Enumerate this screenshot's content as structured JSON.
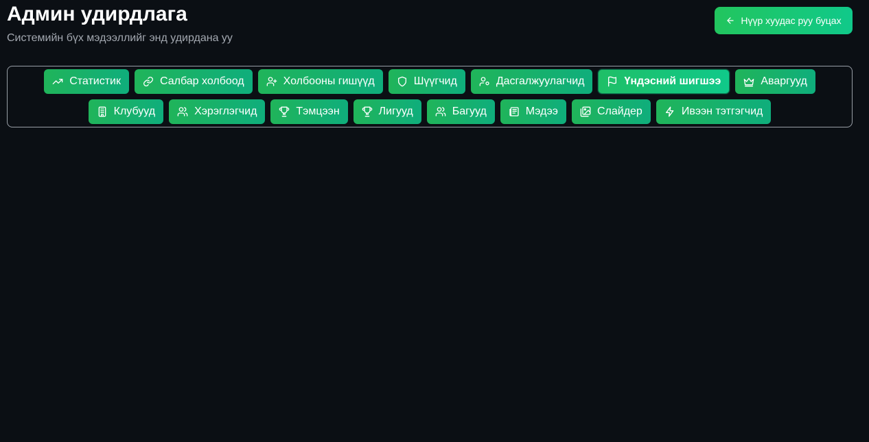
{
  "header": {
    "title": "Админ удирдлага",
    "subtitle": "Системийн бүх мэдээллийг энд удирдана уу"
  },
  "back_button": {
    "label": "Нүүр хуудас руу буцах",
    "icon": "arrow-left-icon"
  },
  "colors": {
    "background": "#0b0f14",
    "accent_start": "#22c55e",
    "accent_end": "#10c98a"
  },
  "tabs": [
    {
      "label": "Статистик",
      "icon": "trending-up-icon"
    },
    {
      "label": "Салбар холбоод",
      "icon": "link-icon"
    },
    {
      "label": "Холбооны гишүүд",
      "icon": "user-plus-icon"
    },
    {
      "label": "Шүүгчид",
      "icon": "shield-icon"
    },
    {
      "label": "Дасгалжуулагчид",
      "icon": "user-cog-icon"
    },
    {
      "label": "Үндэсний шигшээ",
      "icon": "flag-icon",
      "active": true
    },
    {
      "label": "Аваргууд",
      "icon": "crown-icon"
    },
    {
      "label": "Клубууд",
      "icon": "building-icon"
    },
    {
      "label": "Хэрэглэгчид",
      "icon": "users-icon"
    },
    {
      "label": "Тэмцээн",
      "icon": "trophy-icon"
    },
    {
      "label": "Лигууд",
      "icon": "trophy-icon"
    },
    {
      "label": "Багууд",
      "icon": "users-icon"
    },
    {
      "label": "Мэдээ",
      "icon": "newspaper-icon"
    },
    {
      "label": "Слайдер",
      "icon": "images-icon"
    },
    {
      "label": "Ивээн тэтгэгчид",
      "icon": "zap-icon"
    }
  ]
}
